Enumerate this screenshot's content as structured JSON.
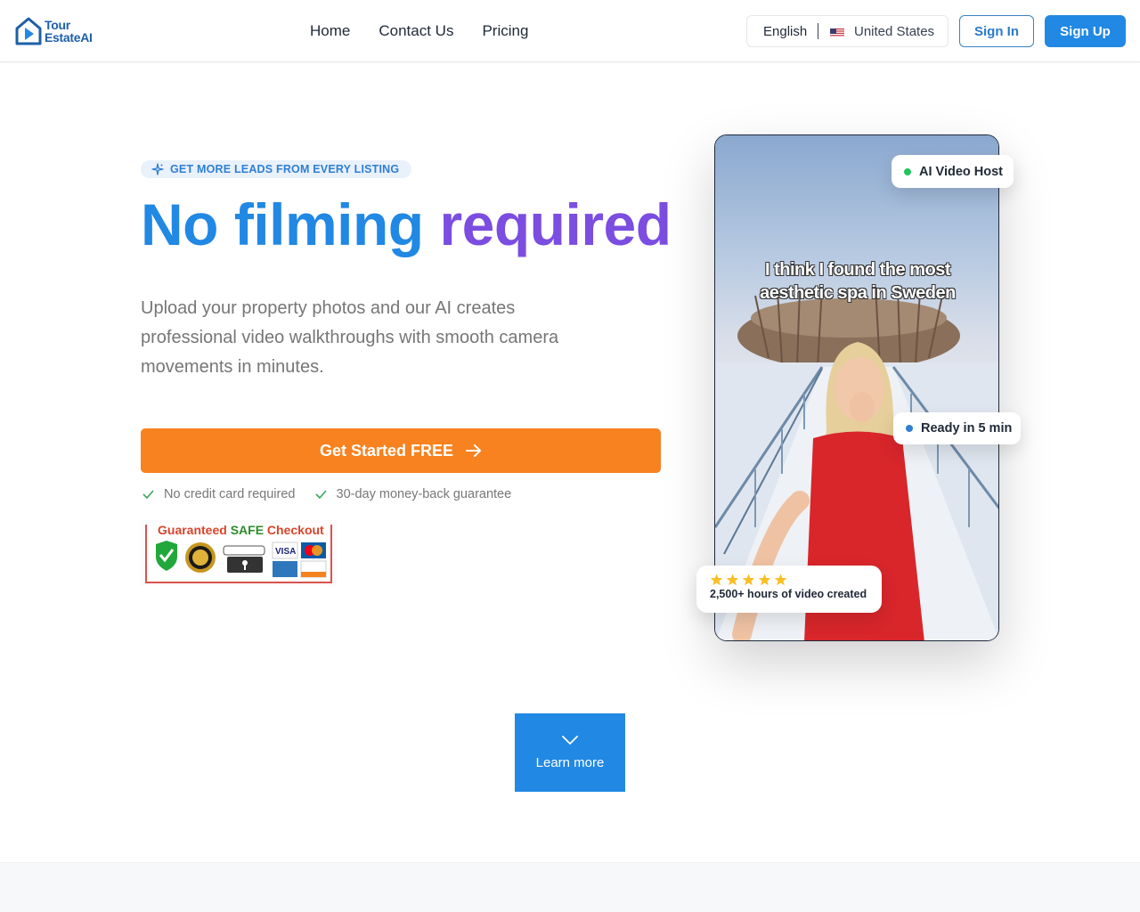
{
  "brand": {
    "name_line1": "Tour",
    "name_line2": "EstateAI",
    "color": "#1e5fa8"
  },
  "nav": {
    "items": [
      {
        "label": "Home"
      },
      {
        "label": "Contact Us"
      },
      {
        "label": "Pricing"
      }
    ]
  },
  "locale": {
    "language": "English",
    "flag": "us-flag-icon",
    "country": "United States"
  },
  "auth": {
    "signin_label": "Sign In",
    "signup_label": "Sign Up"
  },
  "hero": {
    "pill_icon": "sparkle-icon",
    "pill_label": "GET MORE LEADS FROM EVERY LISTING",
    "title_part1": "No filming",
    "title_part2": "required",
    "subtitle": "Upload your property photos and our AI creates professional video walkthroughs with smooth camera movements in minutes.",
    "cta_label": "Get Started FREE",
    "cta_icon": "arrow-right-icon",
    "checks": [
      {
        "label": "No credit card required"
      },
      {
        "label": "30-day money-back guarantee"
      }
    ],
    "trust_badge": {
      "title_part1": "Guaranteed ",
      "title_part2": "SAFE",
      "title_part3": " Checkout"
    }
  },
  "video": {
    "caption": "I think I found the most aesthetic spa in Sweden",
    "tag_host": "AI Video Host",
    "tag_ready": "Ready in 5 min",
    "rating_stars": 5,
    "stats_text": "2,500+ hours of video created"
  },
  "learn_more": {
    "label": "Learn more",
    "icon": "chevron-down-icon"
  },
  "colors": {
    "primary": "#2188e3",
    "purple": "#7b4de0",
    "cta": "#f7821f",
    "green_dot": "#22c55e",
    "blue_dot": "#2f7fd3",
    "star": "#fbbf24"
  }
}
